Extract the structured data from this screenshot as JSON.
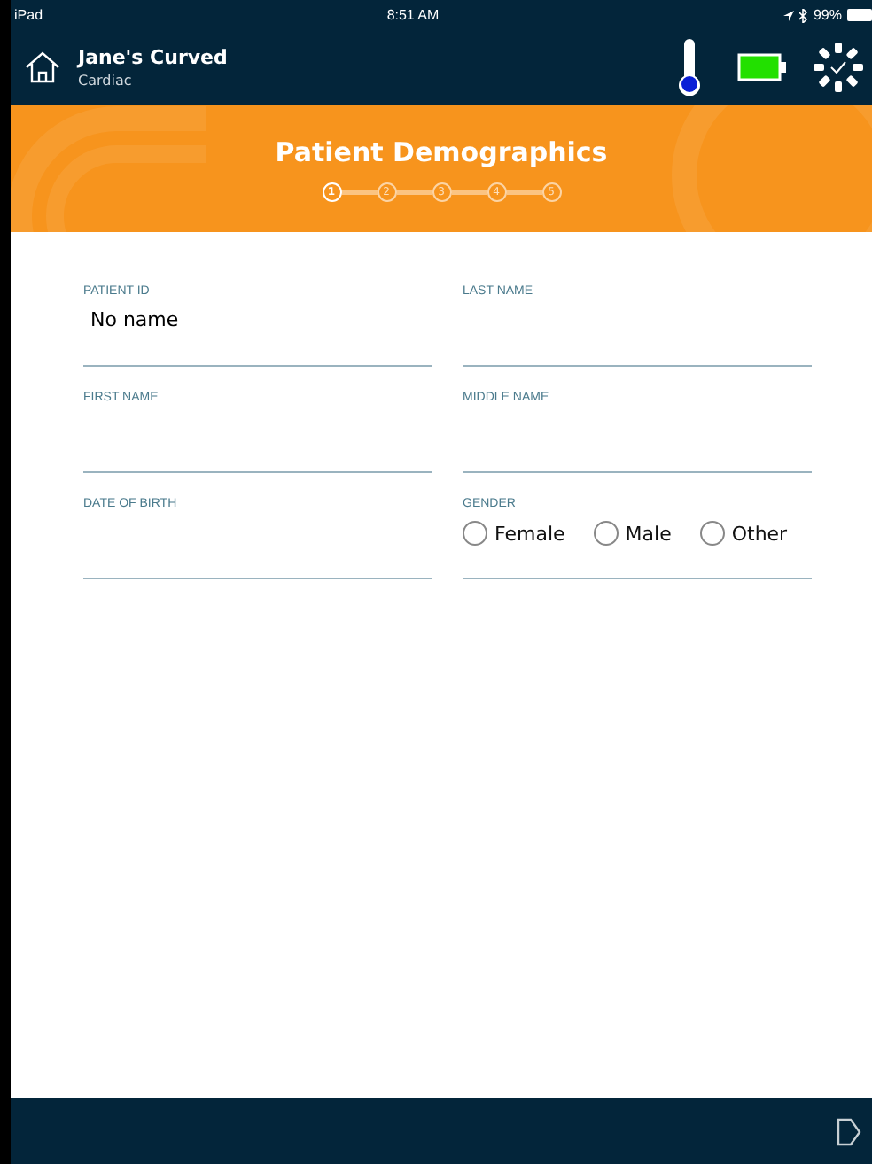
{
  "status_bar": {
    "device": "iPad",
    "time": "8:51 AM",
    "battery": "99%"
  },
  "header": {
    "title": "Jane's Curved",
    "subtitle": "Cardiac"
  },
  "banner": {
    "title": "Patient Demographics",
    "steps": [
      {
        "label": "1",
        "selected": true
      },
      {
        "label": "2",
        "selected": false
      },
      {
        "label": "3",
        "selected": false
      },
      {
        "label": "4",
        "selected": false
      },
      {
        "label": "5",
        "selected": false
      }
    ]
  },
  "fields": [
    {
      "kind": "text",
      "label": "PATIENT ID",
      "value": "No name"
    },
    {
      "kind": "text",
      "label": "LAST NAME"
    },
    {
      "kind": "text",
      "label": "FIRST NAME"
    },
    {
      "kind": "text",
      "label": "MIDDLE NAME"
    },
    {
      "kind": "text",
      "label": "DATE OF BIRTH"
    },
    {
      "kind": "radio",
      "label": "GENDER",
      "options": [
        {
          "label": "Female",
          "selected": false
        },
        {
          "label": "Male",
          "selected": false
        },
        {
          "label": "Other",
          "selected": false
        }
      ]
    }
  ]
}
